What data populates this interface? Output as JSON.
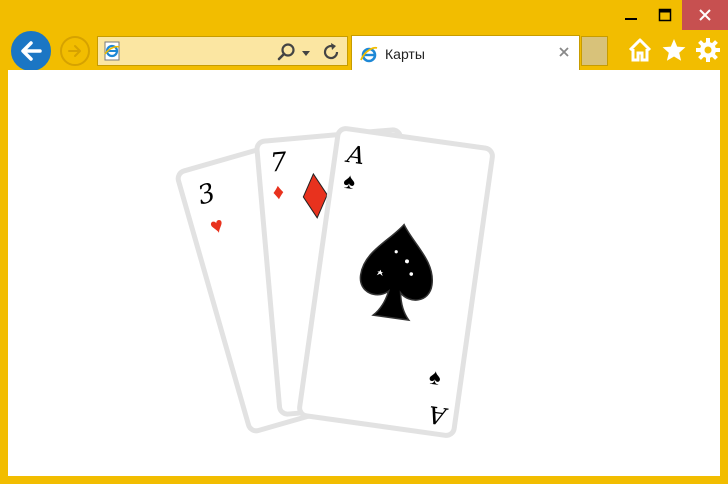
{
  "window": {
    "controls": {
      "minimize": "minimize",
      "maximize": "maximize",
      "close": "close"
    }
  },
  "nav": {
    "address_value": "",
    "address_placeholder": ""
  },
  "tab": {
    "title": "Карты"
  },
  "toolbar_icons": [
    "home-icon",
    "favorites-star-icon",
    "settings-gear-icon"
  ],
  "cards": [
    {
      "rank": "3",
      "suit": "hearts",
      "suit_symbol": "♥",
      "color": "#e8321e"
    },
    {
      "rank": "7",
      "suit": "diamonds",
      "suit_symbol": "♦",
      "color": "#e8321e"
    },
    {
      "rank": "A",
      "suit": "spades",
      "suit_symbol": "♠",
      "color": "#000000"
    }
  ],
  "colors": {
    "chrome": "#f2bd00",
    "back_button": "#1b76c4",
    "close_button": "#c75050"
  }
}
